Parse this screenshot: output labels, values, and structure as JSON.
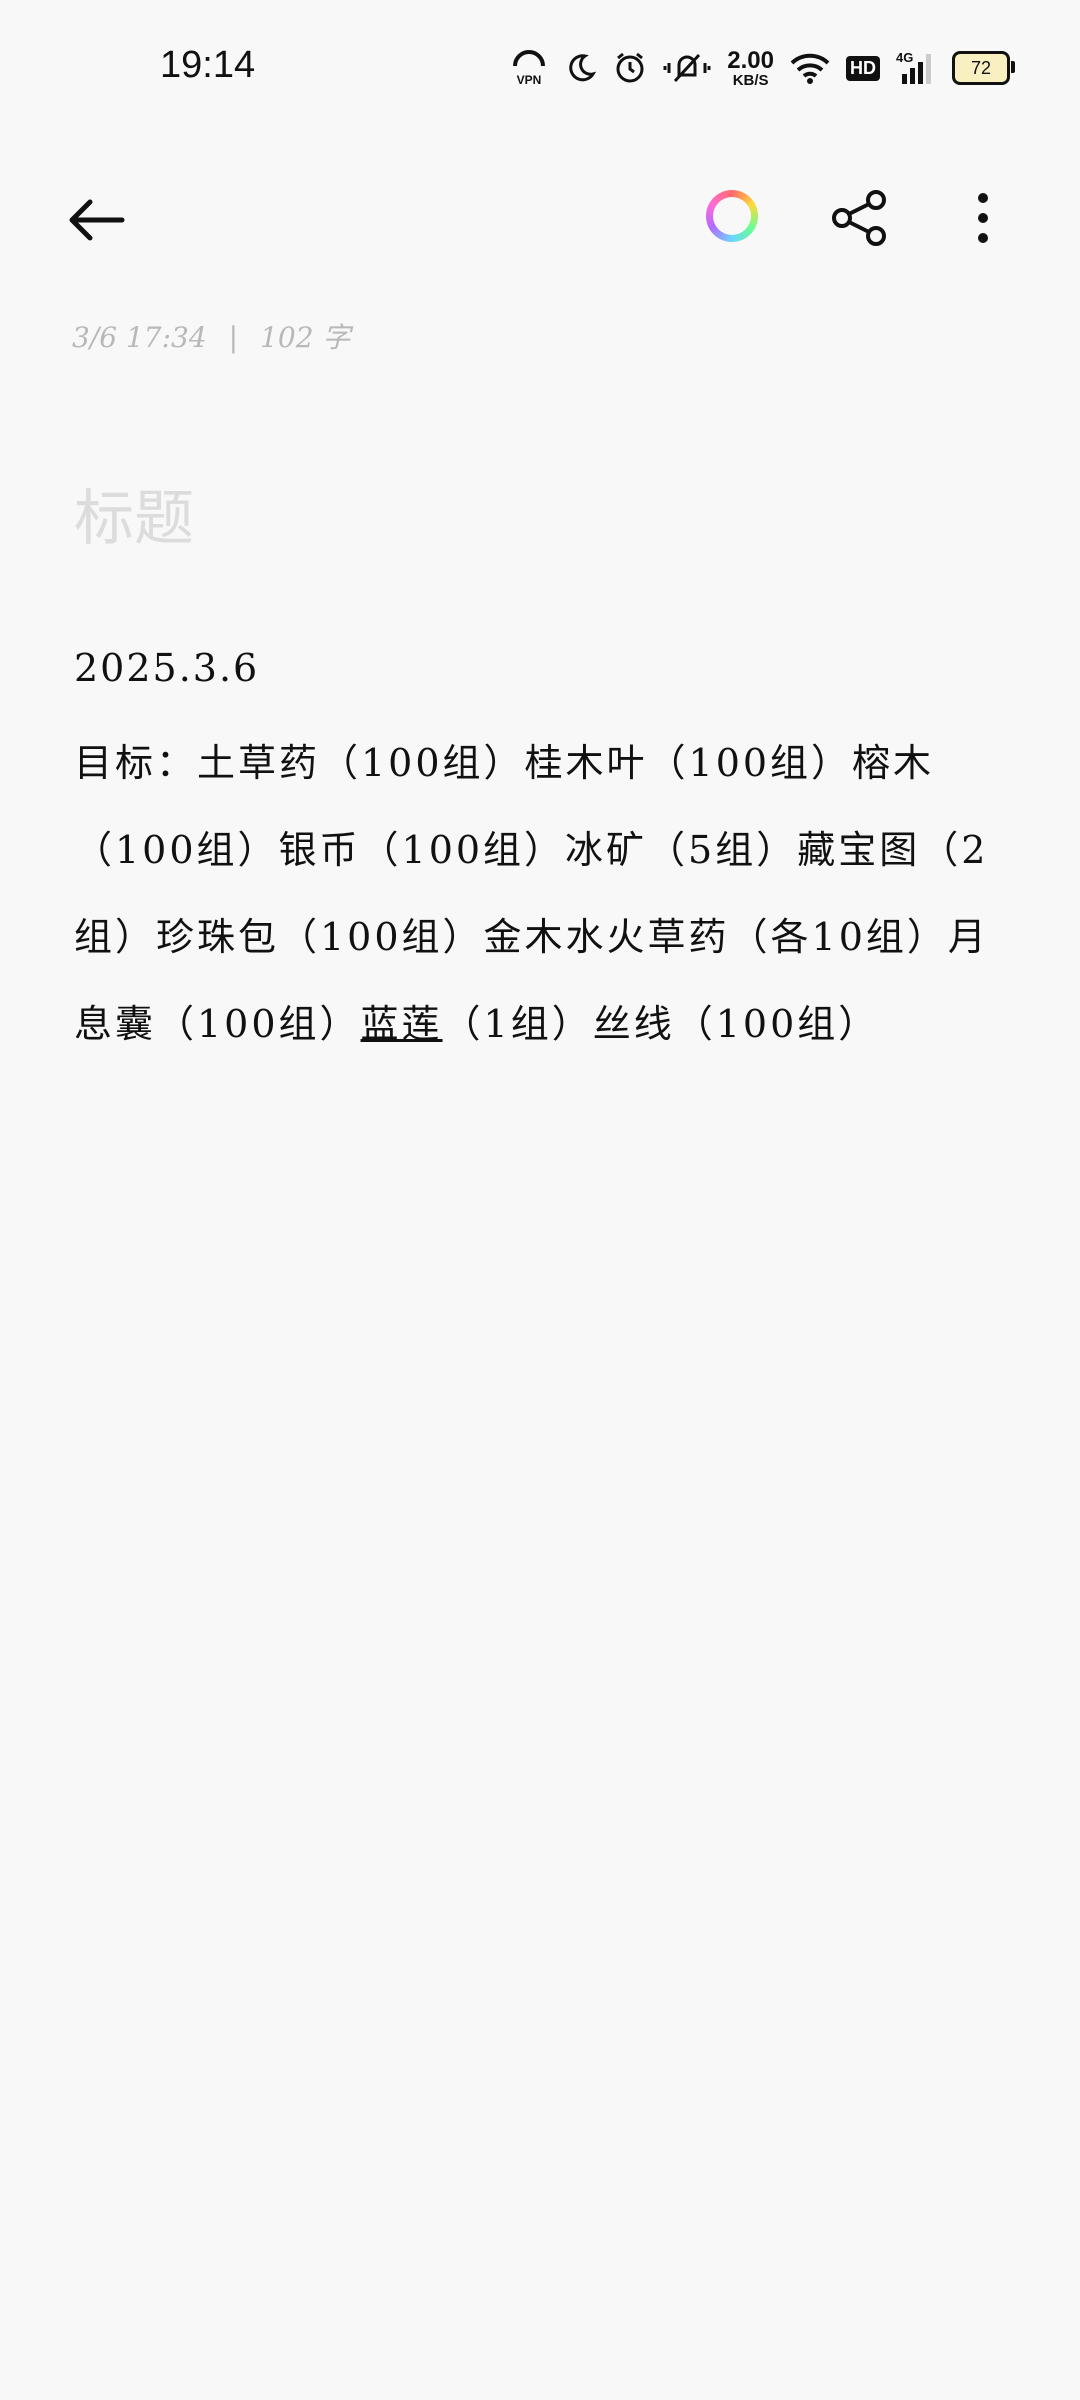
{
  "status_bar": {
    "time": "19:14",
    "net_speed_value": "2.00",
    "net_speed_unit": "KB/S",
    "hd_label": "HD",
    "network_label": "4G",
    "battery": "72"
  },
  "note": {
    "meta_date": "3/6 17:34",
    "meta_separator": "|",
    "meta_count": "102 字",
    "title_placeholder": "标题",
    "date_line": "2025.3.6",
    "body_part1": "目标：土草药（100组）桂木叶（100组）榕木（100组）银币（100组）冰矿（5组）藏宝图（2组）珍珠包（100组）金木水火草药（各10组）月息囊（100组）",
    "body_underlined": "蓝莲",
    "body_part2": "（1组）丝线（100组）"
  },
  "icons": {
    "back": "back-arrow-icon",
    "theme": "color-theme-icon",
    "share": "share-icon",
    "more": "more-vertical-icon"
  }
}
